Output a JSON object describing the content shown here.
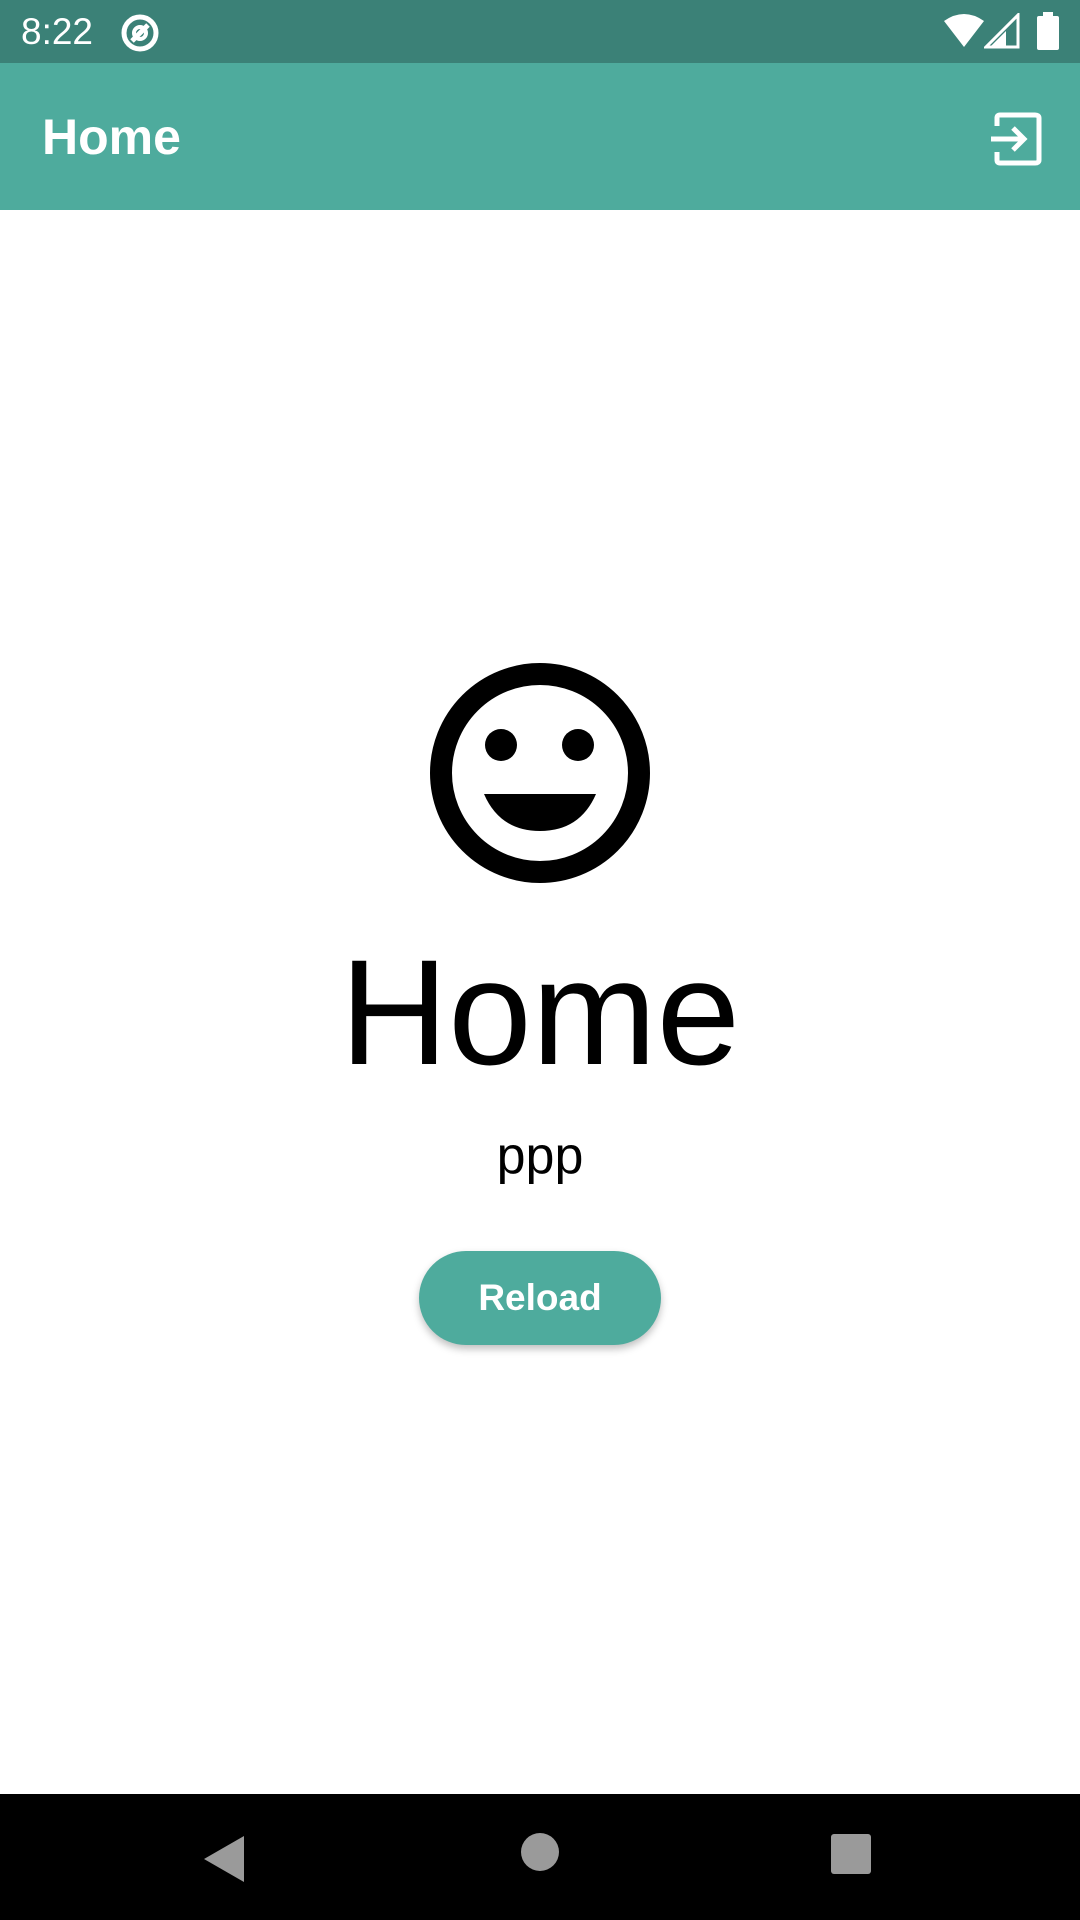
{
  "status_bar": {
    "time": "8:22",
    "icons": [
      "notification-icon",
      "wifi-icon",
      "signal-icon",
      "battery-icon"
    ]
  },
  "app_bar": {
    "title": "Home",
    "action_icon": "logout-icon",
    "color": "#4eab9d"
  },
  "main": {
    "icon": "smiley-face-icon",
    "heading": "Home",
    "subtitle": "ppp",
    "reload_label": "Reload"
  },
  "nav_bar": {
    "icons": [
      "back-icon",
      "home-icon",
      "recents-icon"
    ]
  },
  "colors": {
    "status_bar": "#3b8177",
    "accent": "#4eab9d",
    "background": "#ffffff"
  }
}
